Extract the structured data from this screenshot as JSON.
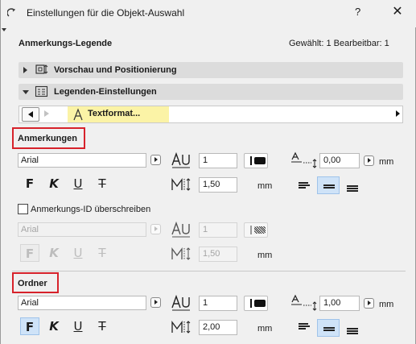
{
  "window": {
    "title": "Einstellungen für die Objekt-Auswahl",
    "help_label": "?",
    "close_label": "✕"
  },
  "header": {
    "section_title": "Anmerkungs-Legende",
    "selection_status": "Gewählt: 1 Bearbeitbar: 1"
  },
  "panels": {
    "preview": "Vorschau und Positionierung",
    "legend": "Legenden-Einstellungen"
  },
  "tabbar": {
    "active_tab": "Textformat..."
  },
  "annotations": {
    "heading": "Anmerkungen",
    "font": "Arial",
    "pen": "1",
    "offset": "0,00",
    "offset_unit": "mm",
    "size": "1,50",
    "size_unit": "mm",
    "format_bold": "F",
    "format_italic": "K",
    "format_underline": "U",
    "format_strike": "T",
    "bold_active": false
  },
  "id_override": {
    "checkbox_label": "Anmerkungs-ID überschreiben",
    "checked": false,
    "font": "Arial",
    "pen": "1",
    "size": "1,50",
    "size_unit": "mm",
    "format_bold": "F",
    "format_italic": "K",
    "format_underline": "U",
    "format_strike": "T"
  },
  "folder": {
    "heading": "Ordner",
    "font": "Arial",
    "pen": "1",
    "offset": "1,00",
    "offset_unit": "mm",
    "size": "2,00",
    "size_unit": "mm",
    "format_bold": "F",
    "format_italic": "K",
    "format_underline": "U",
    "format_strike": "T",
    "bold_active": true
  },
  "colors": {
    "accent": "#d7222b",
    "tab_highlight": "#fbf3a6",
    "toggle_on": "#cfe3f8"
  }
}
